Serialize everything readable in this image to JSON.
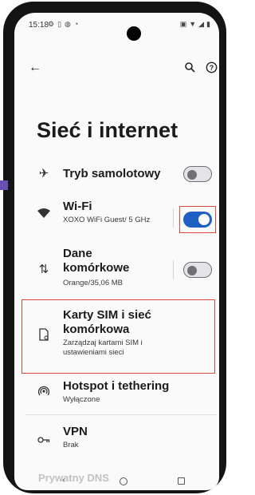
{
  "status": {
    "time": "15:18",
    "icons_left": [
      "settings-icon",
      "sim-icon",
      "shield-icon",
      "alarm-icon"
    ],
    "icons_right": [
      "vibrate-icon",
      "wifi-icon",
      "signal-icon",
      "battery-icon"
    ]
  },
  "topbar": {
    "back_icon": "arrow-left-icon",
    "search_icon": "search-icon",
    "help_icon": "help-icon"
  },
  "page": {
    "title": "Sieć i internet"
  },
  "items": [
    {
      "key": "airplane",
      "icon": "airplane-icon",
      "title": "Tryb samolotowy",
      "subtitle": "",
      "toggle": "off"
    },
    {
      "key": "wifi",
      "icon": "wifi-icon",
      "title": "Wi-Fi",
      "subtitle": "XOXO WiFi Guest/ 5 GHz",
      "toggle": "on"
    },
    {
      "key": "mobile-data",
      "icon": "data-arrows-icon",
      "title": "Dane komórkowe",
      "subtitle": "Orange/35,06 MB",
      "toggle": "off"
    },
    {
      "key": "sim",
      "icon": "sim-card-icon",
      "title": "Karty SIM i sieć komórkowa",
      "subtitle": "Zarządzaj kartami SIM i ustawieniami sieci"
    },
    {
      "key": "hotspot",
      "icon": "hotspot-icon",
      "title": "Hotspot i tethering",
      "subtitle": "Wyłączone"
    },
    {
      "key": "vpn",
      "icon": "vpn-key-icon",
      "title": "VPN",
      "subtitle": "Brak"
    }
  ],
  "partial_item": {
    "title": "Prywatny DNS"
  },
  "navbar": {
    "back_icon": "nav-back-icon",
    "home_icon": "nav-home-icon",
    "recents_icon": "nav-recents-icon"
  },
  "colors": {
    "accent": "#1f5fc3",
    "highlight": "#e0473f"
  }
}
